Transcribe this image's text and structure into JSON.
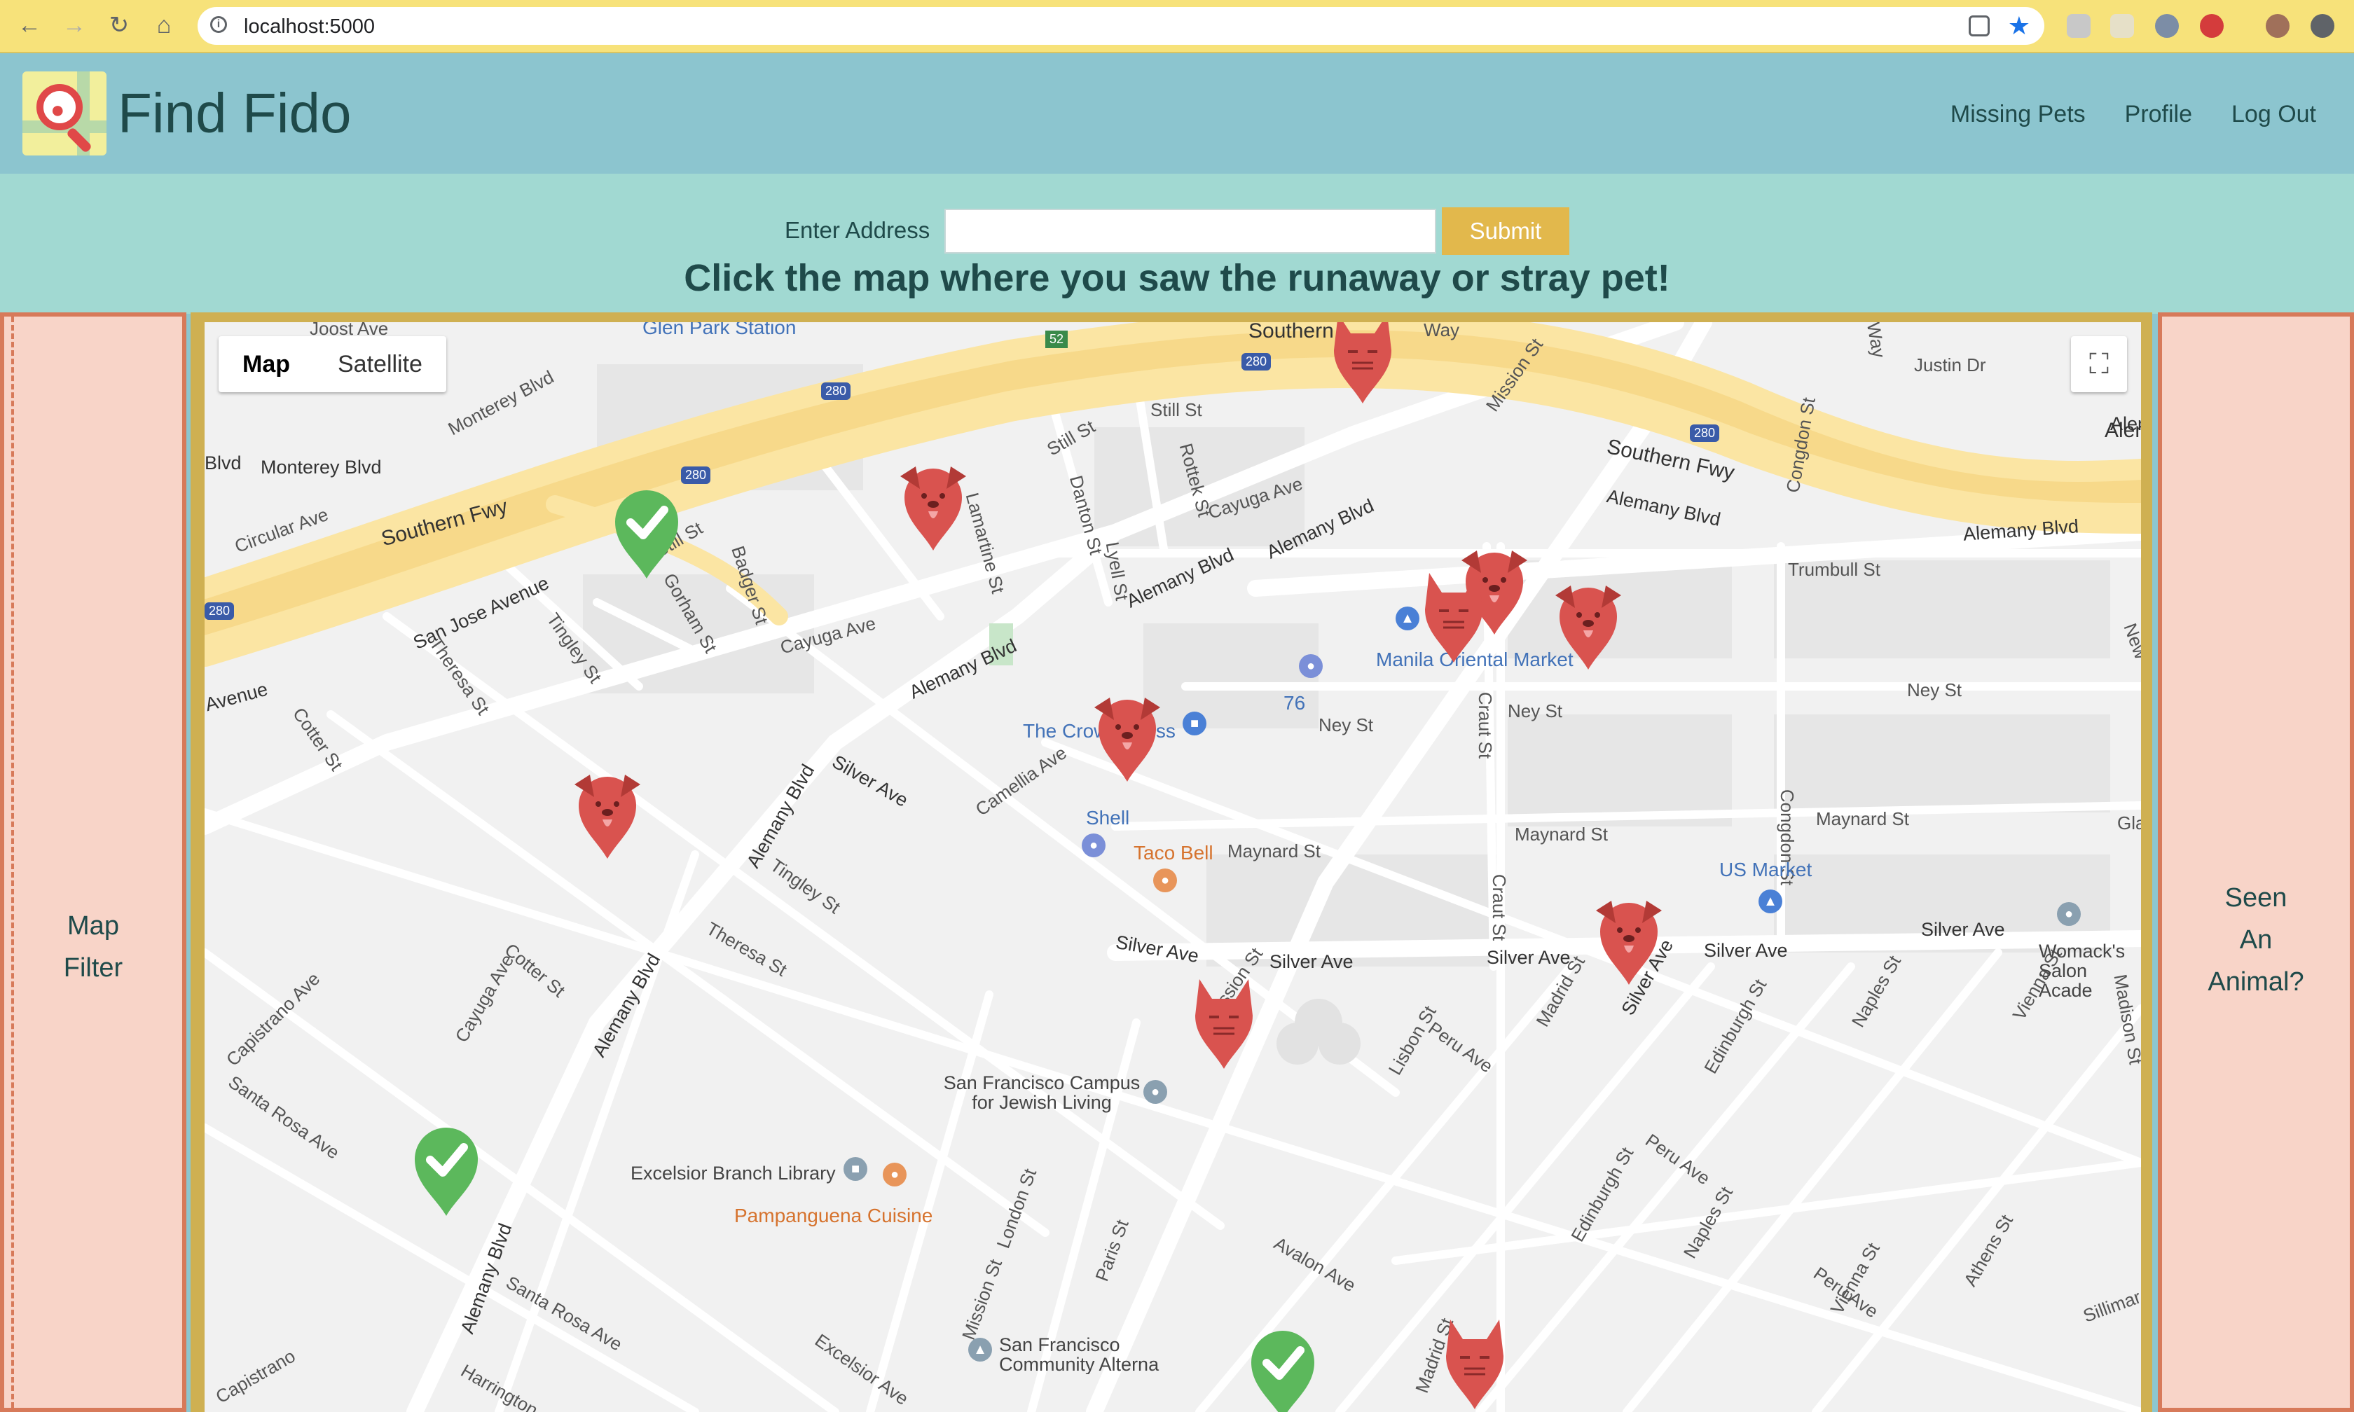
{
  "browser": {
    "url": "localhost:5000"
  },
  "app": {
    "brand": "Find Fido",
    "nav": [
      "Missing Pets",
      "Profile",
      "Log Out"
    ]
  },
  "address": {
    "label": "Enter Address",
    "input_value": "",
    "submit": "Submit",
    "headline": "Click the map where you saw the runaway or stray pet!"
  },
  "sidebar_left": {
    "lines": [
      "Map",
      "Filter"
    ]
  },
  "sidebar_right": {
    "lines": [
      "Seen",
      "An",
      "Animal?"
    ]
  },
  "map": {
    "type_buttons": [
      "Map",
      "Satellite"
    ],
    "active_type": "Map",
    "streets": [
      "Joost Ave",
      "Glen Park Station",
      "Southern",
      "Southern Fwy",
      "Southern Fwy",
      "Monterey Blvd",
      "Monterey Blvd",
      "Blvd",
      "Circular Ave",
      "Still St",
      "Still St",
      "Still St",
      "Rottek St",
      "Cayuga Ave",
      "Cayuga Ave",
      "Lamartine St",
      "Danton St",
      "Badger St",
      "Gorham St",
      "Tingley St",
      "Tingley St",
      "San Jose Avenue",
      "Alemany Blvd",
      "Alemany Blvd",
      "Alemany Blvd",
      "Alemany Blvd",
      "Alemany Blvd",
      "Alemany Blvd",
      "Alemany Blvd",
      "Alemany Blvd",
      "Lyell St",
      "Mission St",
      "Mission St",
      "Mission St",
      "Justin Dr",
      "Alemany Blvd",
      "Aleman",
      "Trumbull St",
      "Ney St",
      "Ney St",
      "Ney St",
      "Craut St",
      "Craut St",
      "Maynard St",
      "Maynard St",
      "Maynard St",
      "Congdon St",
      "Congdon St",
      "Silver Ave",
      "Silver Ave",
      "Silver Ave",
      "Silver Ave",
      "Silver Ave",
      "Silver Ave",
      "Silver Ave",
      "Camellia Ave",
      "Theresa St",
      "Theresa St",
      "Cotter St",
      "Cotter St",
      "Capistrano Ave",
      "Santa Rosa Ave",
      "Santa Rosa Ave",
      "Cayuga Ave",
      "London St",
      "Paris St",
      "Excelsior Ave",
      "Harrington",
      "Lisbon St",
      "Peru Ave",
      "Peru Ave",
      "Peru Ave",
      "Madrid St",
      "Madrid St",
      "Edinburgh St",
      "Edinburgh St",
      "Naples St",
      "Naples St",
      "Vienna St",
      "Vienna St",
      "Athens St",
      "Madison St",
      "Avalon Ave",
      "Sillimar",
      "Glad",
      "Avenue",
      "Way",
      "Way",
      "New",
      "Capistrano"
    ],
    "places": [
      "Manila Oriental Market",
      "The Crown Cross",
      "Shell",
      "Taco Bell",
      "US Market",
      "Womack's Salon Acade",
      "San Francisco Campus for Jewish Living",
      "Excelsior Branch Library",
      "Pampanguena Cuisine",
      "San Francisco Community Alterna",
      "76"
    ],
    "highway_shields": [
      "280",
      "280",
      "280",
      "280",
      "280",
      "52"
    ],
    "markers": [
      {
        "kind": "cat",
        "color": "#d9534f"
      },
      {
        "kind": "dog",
        "color": "#d9534f"
      },
      {
        "kind": "found",
        "color": "#5cb85c"
      },
      {
        "kind": "dog",
        "color": "#d9534f"
      },
      {
        "kind": "cat",
        "color": "#d9534f"
      },
      {
        "kind": "dog",
        "color": "#d9534f"
      },
      {
        "kind": "dog",
        "color": "#d9534f"
      },
      {
        "kind": "dog",
        "color": "#d9534f"
      },
      {
        "kind": "dog",
        "color": "#d9534f"
      },
      {
        "kind": "cat",
        "color": "#d9534f"
      },
      {
        "kind": "found",
        "color": "#5cb85c"
      },
      {
        "kind": "found",
        "color": "#5cb85c"
      },
      {
        "kind": "cat",
        "color": "#d9534f"
      }
    ]
  },
  "colors": {
    "header": "#8cc5cf",
    "address_band": "#a1d9d2",
    "side_panel": "#f8d4c8",
    "side_border": "#d77a5a",
    "map_border": "#cfb052",
    "submit": "#e2b84c",
    "text": "#1f4a4a"
  }
}
